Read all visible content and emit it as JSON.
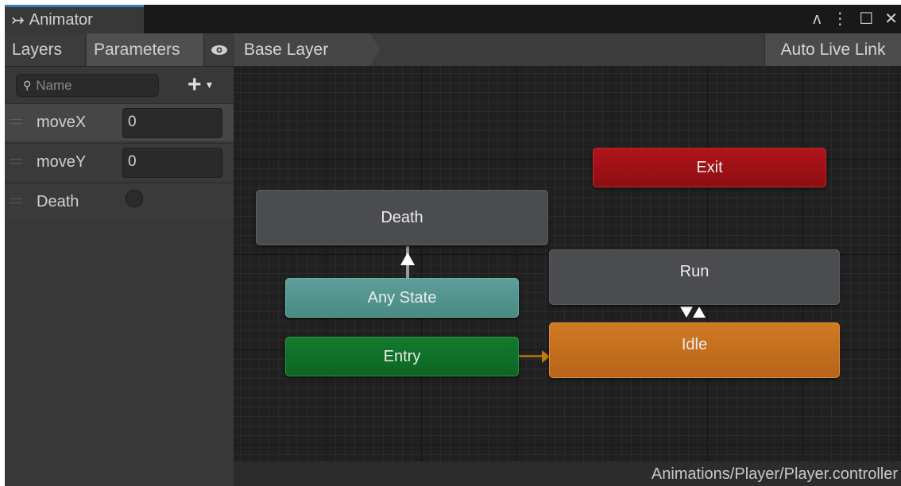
{
  "window": {
    "tab_label": "Animator",
    "tab_icon": "animator-icon",
    "controls": {
      "lock_icon": "ᴧ",
      "menu_icon": "⋮",
      "maximize_icon": "☐",
      "close_icon": "✕"
    }
  },
  "toolbar": {
    "layers_label": "Layers",
    "parameters_label": "Parameters",
    "eye_icon": "eye-icon",
    "breadcrumb": "Base Layer",
    "live_link_label": "Auto Live Link"
  },
  "parameters": {
    "search_placeholder": "Name",
    "add_icon": "+",
    "items": [
      {
        "name": "moveX",
        "type": "float",
        "value": "0"
      },
      {
        "name": "moveY",
        "type": "float",
        "value": "0"
      },
      {
        "name": "Death",
        "type": "bool",
        "value": "false"
      }
    ]
  },
  "graph": {
    "states": {
      "death": "Death",
      "exit": "Exit",
      "run": "Run",
      "any_state": "Any State",
      "entry": "Entry",
      "idle": "Idle"
    },
    "colors": {
      "default_state": "#4a4c50",
      "exit": "#a01116",
      "any_state": "#5a9d96",
      "entry": "#117029",
      "idle": "#c8701f"
    }
  },
  "status": {
    "path": "Animations/Player/Player.controller"
  }
}
